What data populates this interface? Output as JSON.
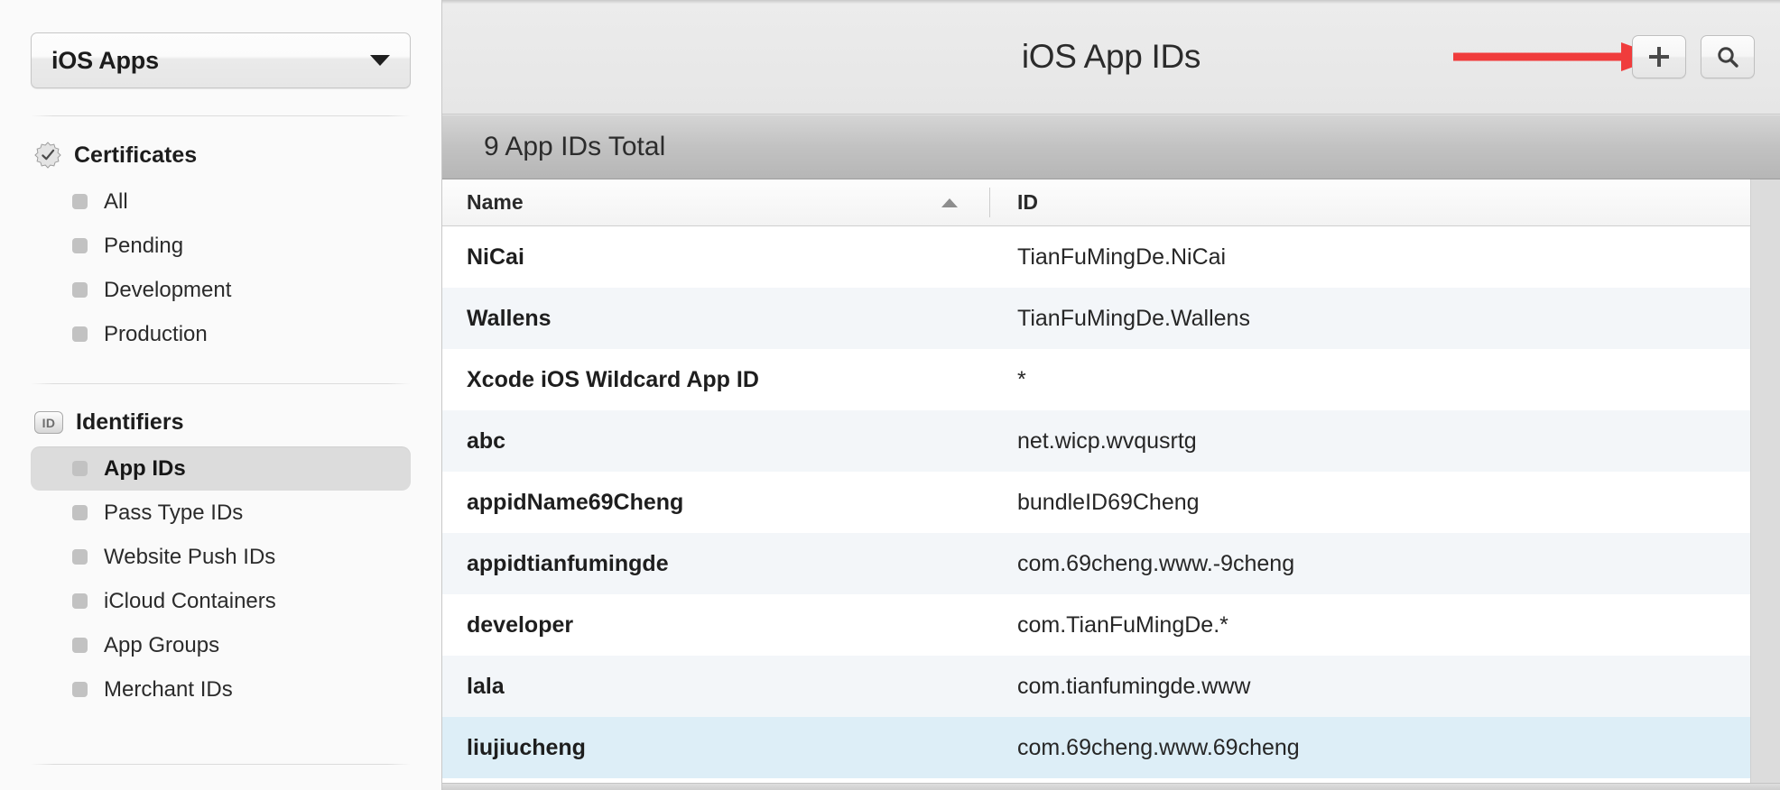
{
  "sidebar": {
    "team_popup": {
      "label": "iOS Apps",
      "caret_icon": "chevron-down-icon"
    },
    "groups": [
      {
        "title": "Certificates",
        "icon": "certificate-seal-icon",
        "items": [
          {
            "label": "All",
            "selected": false
          },
          {
            "label": "Pending",
            "selected": false
          },
          {
            "label": "Development",
            "selected": false
          },
          {
            "label": "Production",
            "selected": false
          }
        ]
      },
      {
        "title": "Identifiers",
        "icon": "id-badge-icon",
        "icon_text": "ID",
        "items": [
          {
            "label": "App IDs",
            "selected": true
          },
          {
            "label": "Pass Type IDs",
            "selected": false
          },
          {
            "label": "Website Push IDs",
            "selected": false
          },
          {
            "label": "iCloud Containers",
            "selected": false
          },
          {
            "label": "App Groups",
            "selected": false
          },
          {
            "label": "Merchant IDs",
            "selected": false
          }
        ]
      }
    ]
  },
  "header": {
    "title": "iOS App IDs",
    "add_button": {
      "icon": "plus-icon",
      "label": "+"
    },
    "search_button": {
      "icon": "search-icon",
      "label": "Search"
    },
    "annotation_arrow": {
      "color": "#F03C3C",
      "points_to": "add-button"
    }
  },
  "count_bar": {
    "text": "9 App IDs Total"
  },
  "table": {
    "columns": [
      {
        "key": "name",
        "label": "Name",
        "sorted": true,
        "sort_direction": "ascending",
        "sort_icon": "triangle-up-icon"
      },
      {
        "key": "id",
        "label": "ID",
        "sorted": false
      }
    ],
    "rows": [
      {
        "name": "NiCai",
        "id": "TianFuMingDe.NiCai",
        "selected": false
      },
      {
        "name": "Wallens",
        "id": "TianFuMingDe.Wallens",
        "selected": false
      },
      {
        "name": "Xcode iOS Wildcard App ID",
        "id": "*",
        "selected": false
      },
      {
        "name": "abc",
        "id": "net.wicp.wvqusrtg",
        "selected": false
      },
      {
        "name": "appidName69Cheng",
        "id": "bundleID69Cheng",
        "selected": false
      },
      {
        "name": "appidtianfumingde",
        "id": "com.69cheng.www.-9cheng",
        "selected": false
      },
      {
        "name": "developer",
        "id": "com.TianFuMingDe.*",
        "selected": false
      },
      {
        "name": "lala",
        "id": "com.tianfumingde.www",
        "selected": false
      },
      {
        "name": "liujiucheng",
        "id": "com.69cheng.www.69cheng",
        "selected": true
      }
    ]
  },
  "colors": {
    "row_alt": "#f3f6f9",
    "row_selected": "#ddeef7",
    "sidebar_selected": "#dcdcdc",
    "annotation_red": "#F03C3C",
    "count_bar": "#c2c2c2"
  }
}
